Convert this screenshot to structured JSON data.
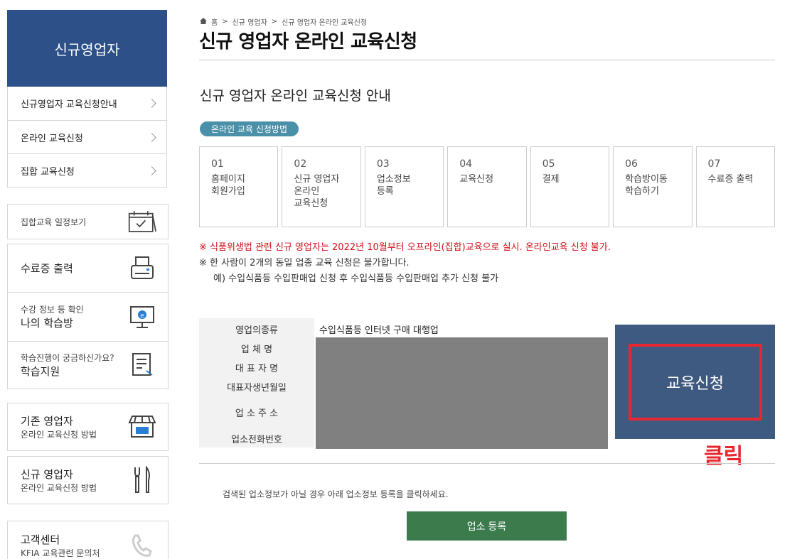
{
  "sidebar": {
    "title": "신규영업자",
    "menu": [
      {
        "label": "신규영업자 교육신청안내"
      },
      {
        "label": "온라인 교육신청"
      },
      {
        "label": "집합 교육신청"
      }
    ],
    "schedule": {
      "label": "집합교육 일정보기",
      "icon": "calendar-check-icon"
    },
    "quick": [
      {
        "small": "",
        "big": "수료증 출력",
        "icon": "printer-icon"
      },
      {
        "small": "수강 정보 등 확인",
        "big": "나의 학습방",
        "icon": "monitor-e-icon"
      },
      {
        "small": "학습진행이 궁금하신가요?",
        "big": "학습지원",
        "icon": "document-pen-icon"
      }
    ],
    "existing": {
      "big": "기존 영업자",
      "small": "온라인 교육신청 방법",
      "icon": "store-icon"
    },
    "new": {
      "big": "신규 영업자",
      "small": "온라인 교육신청 방법",
      "icon": "fork-knife-icon"
    },
    "support": {
      "big": "고객센터",
      "small": "KFIA 교육관련 문의처",
      "icon": "phone-icon"
    }
  },
  "breadcrumb": {
    "home": "홈",
    "level1": "신규 영업자",
    "level2": "신규 영업자 온라인 교육신청"
  },
  "page_title": "신규 영업자 온라인 교육신청",
  "subtitle": "신규 영업자 온라인 교육신청 안내",
  "method_pill": "온라인 교육 신청방법",
  "steps": [
    {
      "num": "01",
      "text": "홈페이지\n회원가입"
    },
    {
      "num": "02",
      "text": "신규 영업자\n온라인\n교육신청"
    },
    {
      "num": "03",
      "text": "업소정보\n등록"
    },
    {
      "num": "04",
      "text": "교육신청"
    },
    {
      "num": "05",
      "text": "결제"
    },
    {
      "num": "06",
      "text": "학습방이동\n학습하기"
    },
    {
      "num": "07",
      "text": "수료증 출력"
    }
  ],
  "notes": {
    "red": "※  식품위생법 관련 신규 영업자는 2022년 10월부터 오프라인(집합)교육으로 실시. 온라인교육 신청 불가.",
    "normal": "※  한 사람이 2개의 동일 업종 교육 신청은 불가합니다.",
    "example": "예) 수입식품등 수입판매업 신청 후 수입식품등 수입판매업 추가 신청 불가"
  },
  "business_info": {
    "labels": [
      "영업의종류",
      "업 체 명",
      "대 표 자 명",
      "대표자생년월일",
      "업 소 주 소",
      "업소전화번호"
    ],
    "business_type_value": "수입식품등 인터넷 구매 대행업"
  },
  "apply_button": "교육신청",
  "click_annotation": "클릭",
  "help_text": "검색된 업소정보가 아닐 경우 아래 업소정보 등록을 클릭하세요.",
  "register_button": "업소 등록"
}
